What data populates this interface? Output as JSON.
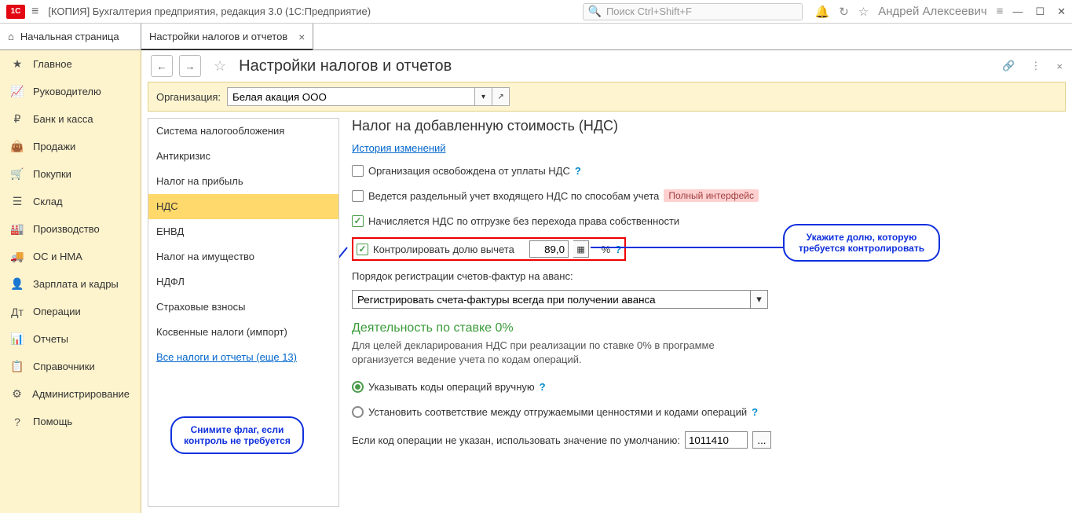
{
  "titlebar": {
    "logo_text": "1C",
    "title": "[КОПИЯ] Бухгалтерия предприятия, редакция 3.0  (1С:Предприятие)",
    "search_placeholder": "Поиск Ctrl+Shift+F",
    "user": "Андрей Алексеевич"
  },
  "tabs": {
    "home": "Начальная страница",
    "active": "Настройки налогов и отчетов"
  },
  "sidebar": [
    "Главное",
    "Руководителю",
    "Банк и касса",
    "Продажи",
    "Покупки",
    "Склад",
    "Производство",
    "ОС и НМА",
    "Зарплата и кадры",
    "Операции",
    "Отчеты",
    "Справочники",
    "Администрирование",
    "Помощь"
  ],
  "sidebar_icons": [
    "★",
    "📈",
    "₽",
    "👜",
    "🛒",
    "☰",
    "🏭",
    "🚚",
    "👤",
    "Дт",
    "📊",
    "📋",
    "⚙",
    "?"
  ],
  "page": {
    "title": "Настройки налогов и отчетов",
    "org_label": "Организация:",
    "org_value": "Белая акация ООО"
  },
  "left_menu": [
    "Система налогообложения",
    "Антикризис",
    "Налог на прибыль",
    "НДС",
    "ЕНВД",
    "Налог на имущество",
    "НДФЛ",
    "Страховые взносы",
    "Косвенные налоги (импорт)",
    "Все налоги и отчеты (еще 13)"
  ],
  "left_active_index": 3,
  "nds": {
    "heading": "Налог на добавленную стоимость (НДС)",
    "history_link": "История изменений",
    "cb1_label": "Организация освобождена от уплаты НДС",
    "cb2_label": "Ведется раздельный учет входящего НДС по способам учета",
    "pink_tag": "Полный интерфейс",
    "cb3_label": "Начисляется НДС по отгрузке без перехода права собственности",
    "cb4_label": "Контролировать долю вычета",
    "ratio_value": "89,0",
    "percent": "%",
    "select_label": "Порядок регистрации счетов-фактур на аванс:",
    "select_value": "Регистрировать счета-фактуры всегда при получении аванса",
    "green_heading": "Деятельность по ставке 0%",
    "green_desc": "Для целей декларирования НДС при реализации по ставке 0% в программе организуется ведение учета по кодам операций.",
    "radio1_label": "Указывать коды операций вручную",
    "radio2_label": "Установить соответствие между отгружаемыми ценностями и кодами операций",
    "default_code_label": "Если код операции не указан, использовать значение по умолчанию:",
    "default_code_value": "1011410"
  },
  "callouts": {
    "left": "Снимите флаг, если контроль не требуется",
    "right_line1": "Укажите долю, которую",
    "right_line2": "требуется контролировать"
  }
}
